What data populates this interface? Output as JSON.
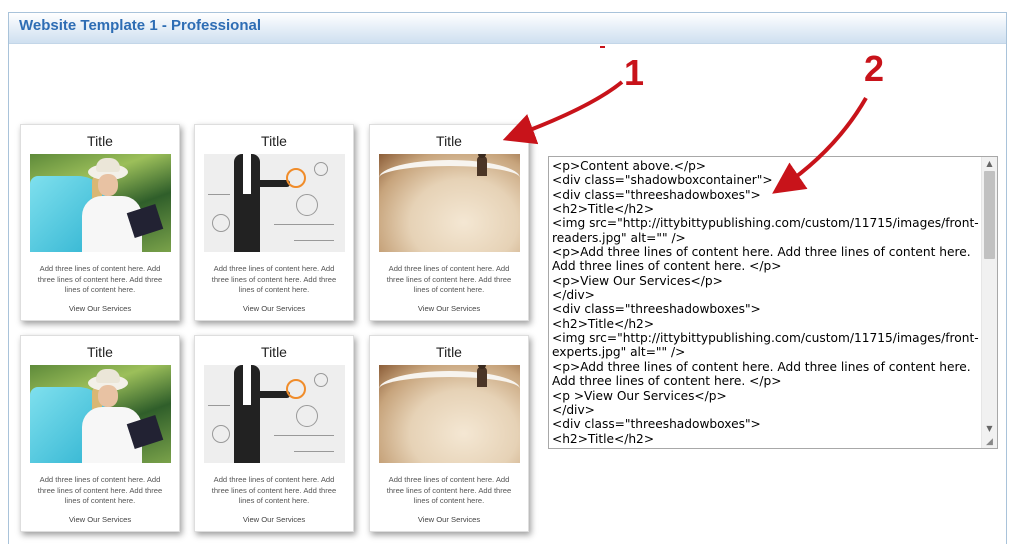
{
  "panel": {
    "title": "Website Template 1 - Professional"
  },
  "cards": [
    {
      "title": "Title",
      "image": "reader-photo",
      "text": "Add three lines of content here. Add three lines of content here. Add three lines of content here.",
      "link": "View Our Services"
    },
    {
      "title": "Title",
      "image": "businessman-photo",
      "text": "Add three lines of content here. Add three lines of content here. Add three lines of content here.",
      "link": "View Our Services"
    },
    {
      "title": "Title",
      "image": "coffee-photo",
      "text": "Add three lines of content here. Add three lines of content here. Add three lines of content here.",
      "link": "View Our Services"
    },
    {
      "title": "Title",
      "image": "reader-photo",
      "text": "Add three lines of content here. Add three lines of content here. Add three lines of content here.",
      "link": "View Our Services"
    },
    {
      "title": "Title",
      "image": "businessman-photo",
      "text": "Add three lines of content here. Add three lines of content here. Add three lines of content here.",
      "link": "View Our Services"
    },
    {
      "title": "Title",
      "image": "coffee-photo",
      "text": "Add three lines of content here. Add three lines of content here. Add three lines of content here.",
      "link": "View Our Services"
    }
  ],
  "code_editor": {
    "lines": [
      "<p>Content above.</p>",
      "<div class=\"shadowboxcontainer\">",
      "<div class=\"threeshadowboxes\">",
      "<h2>Title</h2>",
      "<img src=\"http://ittybittypublishing.com/custom/11715/images/front-readers.jpg\" alt=\"\" />",
      "<p>Add three lines of content here. Add three lines of content here. Add three lines of content here. </p>",
      "<p>View Our Services</p>",
      "</div>",
      "<div class=\"threeshadowboxes\">",
      "<h2>Title</h2>",
      "<img src=\"http://ittybittypublishing.com/custom/11715/images/front-experts.jpg\" alt=\"\" />",
      "<p>Add three lines of content here. Add three lines of content here. Add three lines of content here. </p>",
      "<p >View Our Services</p>",
      "</div>",
      "<div class=\"threeshadowboxes\">",
      "<h2>Title</h2>"
    ],
    "scroll_up_icon": "arrow-up-icon",
    "scroll_down_icon": "arrow-down-icon"
  },
  "annotations": {
    "label_1": "1",
    "label_2": "2",
    "color": "#c8131a"
  }
}
